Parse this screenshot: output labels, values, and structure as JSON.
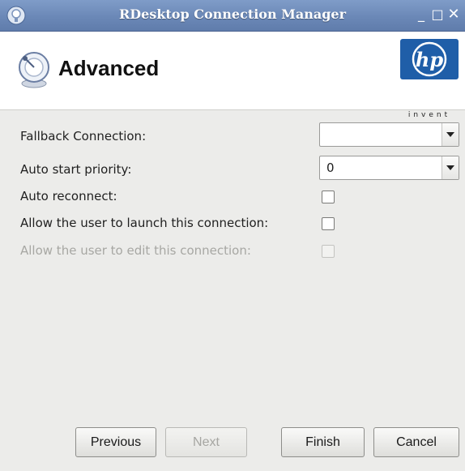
{
  "window": {
    "title": "RDesktop Connection Manager",
    "minimize_glyph": "_",
    "maximize_glyph": "□",
    "close_glyph": "✕"
  },
  "header": {
    "page_title": "Advanced",
    "page_icon": "satellite-dish-icon",
    "logo_text": "hp",
    "logo_tagline": "invent"
  },
  "form": {
    "fallback_connection": {
      "label": "Fallback Connection:",
      "value": ""
    },
    "auto_start_priority": {
      "label": "Auto start priority:",
      "value": "0"
    },
    "auto_reconnect": {
      "label": "Auto reconnect:",
      "checked": false
    },
    "allow_launch": {
      "label": "Allow the user to launch this connection:",
      "checked": false
    },
    "allow_edit": {
      "label": "Allow the user to edit this connection:",
      "checked": false,
      "disabled": true
    }
  },
  "footer": {
    "previous": "Previous",
    "next": "Next",
    "finish": "Finish",
    "cancel": "Cancel"
  },
  "colors": {
    "titlebar": "#6b88b7",
    "logo_blue": "#1f5ea8",
    "disabled_text": "#a7a7a3"
  }
}
